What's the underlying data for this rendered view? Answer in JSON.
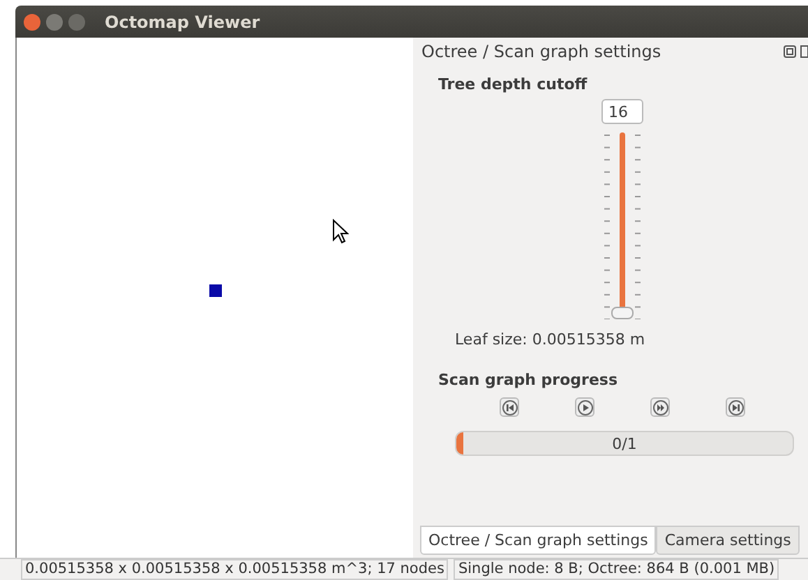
{
  "window": {
    "title": "Octomap Viewer"
  },
  "dock": {
    "title": "Octree / Scan graph settings",
    "depth": {
      "heading": "Tree depth cutoff",
      "value": "16",
      "level": 1,
      "leaf_size_label": "Leaf size:",
      "leaf_size": "0.00515358 m"
    },
    "progress": {
      "heading": "Scan graph progress",
      "level": 0.02,
      "text": "0/1"
    }
  },
  "tabs": [
    {
      "label": "Octree / Scan graph settings",
      "selected": true
    },
    {
      "label": "Camera settings",
      "selected": false
    }
  ],
  "status_bar": [
    "0.00515358 x 0.00515358 x 0.00515358 m^3; 17 nodes",
    "Single node: 8 B; Octree: 864 B (0.001 MB)"
  ]
}
